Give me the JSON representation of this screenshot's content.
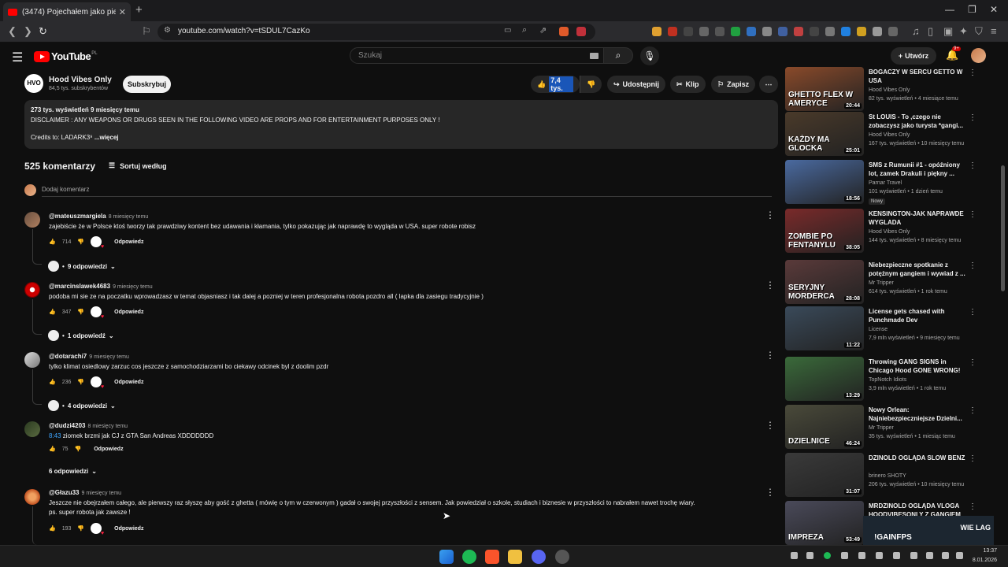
{
  "browser": {
    "tab_title": "(3474) Pojechałem jako pierwszy",
    "url": "youtube.com/watch?v=tSDUL7CazKo"
  },
  "yt": {
    "logo": "YouTube",
    "region": "PL",
    "search_placeholder": "Szukaj",
    "create_label": "Utwórz",
    "notif_count": "9+"
  },
  "video": {
    "channel": "Hood Vibes Only",
    "subscribers": "84,5 tys. subskrybentów",
    "subscribe_label": "Subskrybuj",
    "likes": "7,4 tys.",
    "share_label": "Udostępnij",
    "clip_label": "Klip",
    "save_label": "Zapisz",
    "views_and_date": "273 tys. wyświetleń  9 miesięcy temu",
    "disclaimer": "DISCLAIMER : ANY WEAPONS OR DRUGS SEEN IN THE FOLLOWING VIDEO ARE PROPS AND FOR ENTERTAINMENT PURPOSES ONLY !",
    "credits": "Credits to: LADARK3⁹",
    "more_label": "...więcej"
  },
  "comments": {
    "count_label": "525 komentarzy",
    "sort_label": "Sortuj według",
    "add_placeholder": "Dodaj komentarz",
    "reply_label": "Odpowiedz",
    "items": [
      {
        "author": "@mateuszmargiela",
        "time": "8 miesięcy temu",
        "text": "zajebiście że w Polsce ktoś tworzy tak prawdziwy kontent bez udawania i kłamania, tylko pokazując jak naprawdę to wygląda w USA. super robote robisz",
        "likes": "714",
        "replies": "9 odpowiedzi"
      },
      {
        "author": "@marcinslawek4683",
        "time": "9 miesięcy temu",
        "text": "podoba mi sie ze na poczatku wprowadzasz w temat objasniasz i tak dalej a pozniej w teren profesjonalna robota pozdro all ( lapka dla zasiegu tradycyjnie )",
        "likes": "347",
        "replies": "1 odpowiedź"
      },
      {
        "author": "@dotarachi7",
        "time": "9 miesięcy temu",
        "text": "tylko klimat osiedlowy zarzuc cos jeszcze z samochodziarzami bo ciekawy odcinek byl z doolim pzdr",
        "likes": "236",
        "replies": "4 odpowiedzi"
      },
      {
        "author": "@dudzi4203",
        "time": "8 miesięcy temu",
        "timestamp": "8:43",
        "text": " ziomek brzmi jak CJ z GTA San Andreas XDDDDDDD",
        "likes": "75",
        "replies": "6 odpowiedzi"
      },
      {
        "author": "@Głazu33",
        "time": "9 miesięcy temu",
        "text": "Jeszcze nie obejrzałem całego, ale pierwszy raz słyszę aby gość z ghetta ( mówię o tym w czerwonym ) gadał o swojej przyszłości z sensem. Jak powiedział o szkole, studiach i biznesie w przyszłości to nabrałem nawet trochę wiary.",
        "text2": "ps. super robota jak zawsze !",
        "likes": "193"
      }
    ]
  },
  "sidebar": [
    {
      "title": "BOGACZY W SERCU GETTO W USA",
      "channel": "Hood Vibes Only",
      "stats": "82 tys. wyświetleń • 4 miesiące temu",
      "duration": "20:44",
      "caption": "GHETTO FLEX W AMERYCE",
      "color": "#8a4a2a"
    },
    {
      "title": "St LOUIS - To ,czego nie zobaczysz jako turysta  *gangi...",
      "channel": "Hood Vibes Only",
      "stats": "167 tys. wyświetleń • 10 miesięcy temu",
      "duration": "25:01",
      "caption": "KAŻDY MA GLOCKA",
      "color": "#4a3a2a"
    },
    {
      "title": "SMS z Rumunii #1 - opóźniony lot, zamek Drakuli i piękny ...",
      "channel": "Parnar Travel",
      "stats": "101 wyświetleń • 1 dzień temu",
      "duration": "18:56",
      "caption": "",
      "badge": "Nowy",
      "color": "#4a6aa0"
    },
    {
      "title": "KENSINGTON-JAK NAPRAWDE WYGLADA",
      "channel": "Hood Vibes Only",
      "stats": "144 tys. wyświetleń • 8 miesięcy temu",
      "duration": "38:05",
      "caption": "ZOMBIE PO FENTANYLU",
      "color": "#7a2a2a"
    },
    {
      "title": "Niebezpieczne spotkanie z potężnym gangiem i wywiad z ...",
      "channel": "Mr Tripper",
      "stats": "614 tys. wyświetleń • 1 rok temu",
      "duration": "28:08",
      "caption": "SERYJNY MORDERCA",
      "color": "#5a3a3a"
    },
    {
      "title": "License gets chased with Punchmade Dev",
      "channel": "License",
      "stats": "7,9 mln wyświetleń • 9 miesięcy temu",
      "duration": "11:22",
      "caption": "",
      "color": "#3a4a5a"
    },
    {
      "title": "Throwing GANG SIGNS in Chicago Hood GONE WRONG! ...",
      "channel": "TopNotch Idiots",
      "stats": "3,9 mln wyświetleń • 1 rok temu",
      "duration": "13:29",
      "caption": "",
      "color": "#3a6a3a"
    },
    {
      "title": "Nowy Orlean: Najniebezpieczniejsze Dzielni...",
      "channel": "Mr Tripper",
      "stats": "35 tys. wyświetleń • 1 miesiąc temu",
      "duration": "46:24",
      "caption": "DZIELNICE",
      "color": "#4a4a3a"
    },
    {
      "title": "DZINOLD OGLĄDA SLOW BENZ",
      "channel": "brinero SHOTY",
      "stats": "206 tys. wyświetleń • 10 miesięcy temu",
      "duration": "31:07",
      "caption": "",
      "color": "#3a3a3a"
    },
    {
      "title": "MRDZINOLD OGLĄDA VLOGA HOODVIBESONLY Z GANGIEM",
      "channel": "",
      "stats": "",
      "duration": "53:49",
      "caption": "IMPREZA",
      "color": "#4a4a5a"
    }
  ],
  "overlay": {
    "text": "!GAINFPS",
    "side": "WIE LAG"
  },
  "clock": {
    "time": "13:37",
    "date": "8.01.2026"
  }
}
